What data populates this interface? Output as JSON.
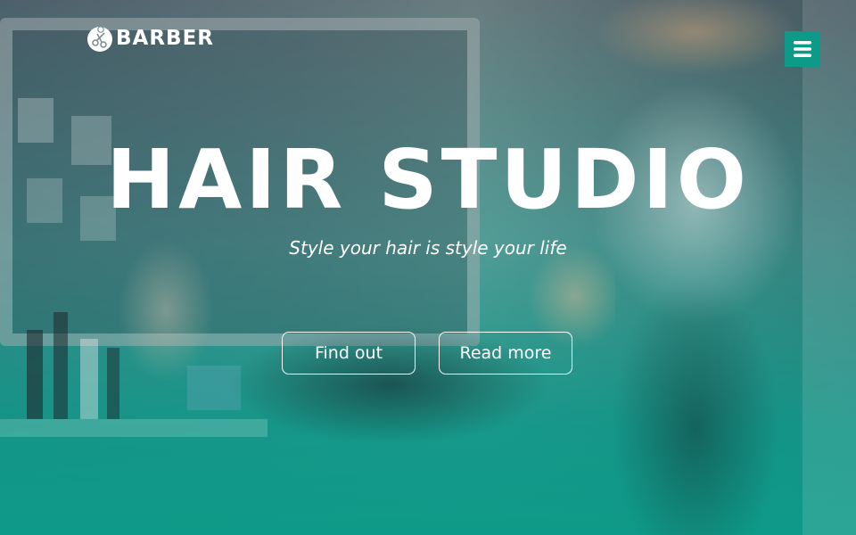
{
  "header": {
    "logo_text": "BARBER",
    "logo_icon": "scissors-person-icon",
    "menu_icon": "hamburger-menu-icon"
  },
  "hero": {
    "title": "HAIR STUDIO",
    "subtitle": "Style your hair is style your life",
    "buttons": [
      {
        "label": "Find out"
      },
      {
        "label": "Read more"
      }
    ]
  },
  "colors": {
    "accent": "#0e9a88",
    "text": "#ffffff"
  }
}
